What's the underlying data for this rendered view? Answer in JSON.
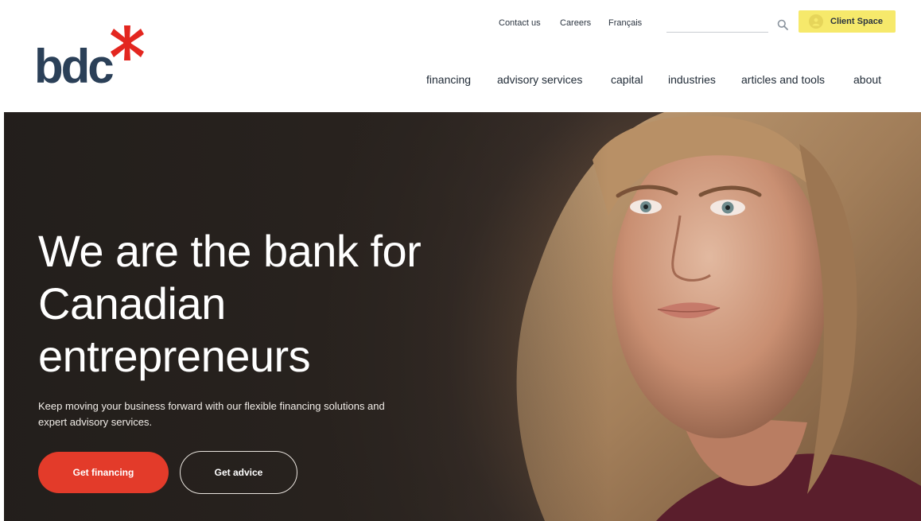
{
  "brand": {
    "logo_text": "bdc",
    "text_color": "#2b4058",
    "asterisk_color": "#e3261f"
  },
  "utility_nav": {
    "contact": "Contact us",
    "careers": "Careers",
    "language": "Français",
    "search_placeholder": "",
    "search_icon": "search-icon",
    "client_space": "Client Space",
    "client_space_icon": "user-avatar-icon",
    "client_space_color": "#f6e96b"
  },
  "main_nav": {
    "items": [
      "financing",
      "advisory services",
      "capital",
      "industries",
      "articles and tools",
      "about"
    ]
  },
  "hero": {
    "title": "We are the bank for Canadian entrepreneurs",
    "subtitle": "Keep moving your business forward with our flexible financing solutions and expert advisory services.",
    "primary_cta": "Get financing",
    "secondary_cta": "Get advice",
    "primary_color": "#e33b2a"
  }
}
